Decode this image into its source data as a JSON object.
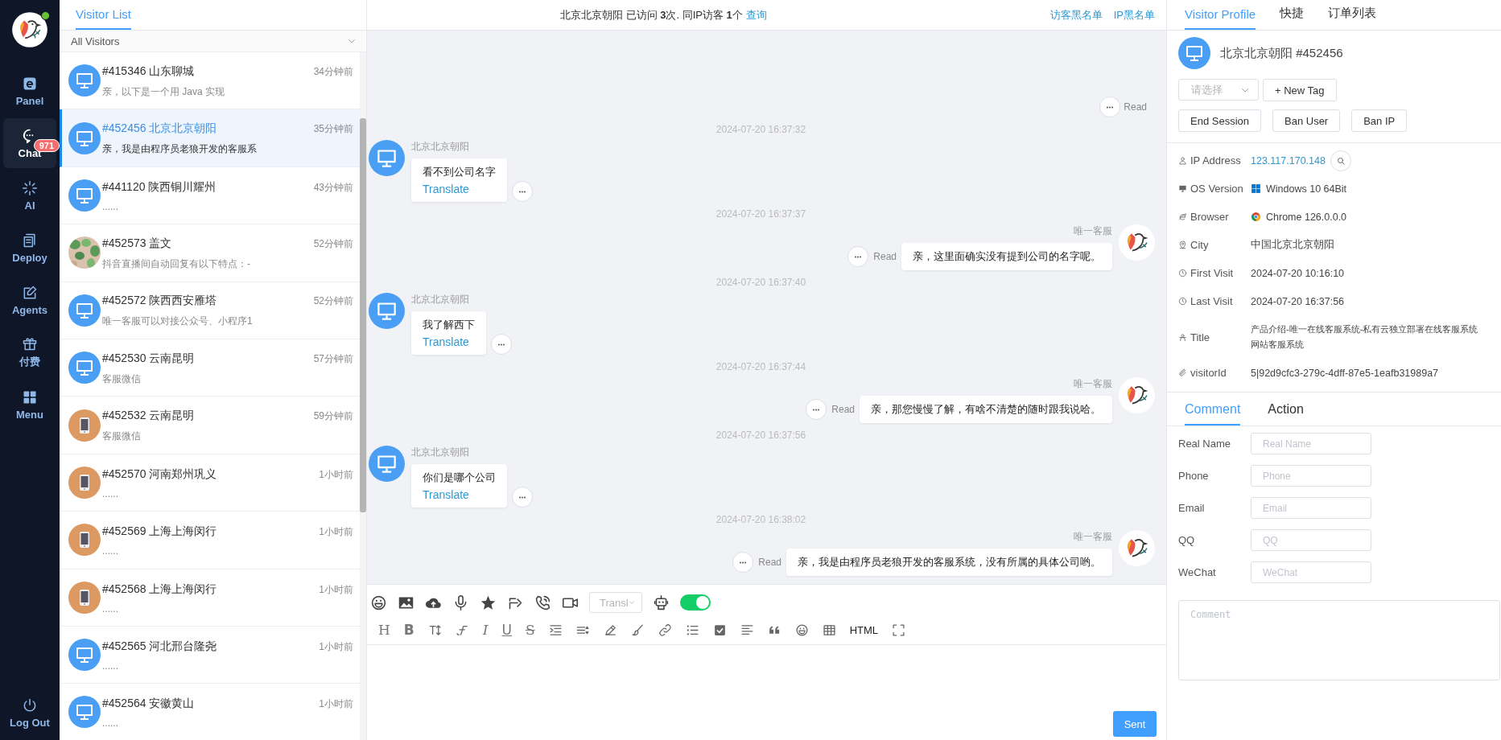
{
  "sidebar": {
    "online": true,
    "items": [
      {
        "label": "Panel",
        "selected": false
      },
      {
        "label": "Chat",
        "selected": true,
        "badge": "971"
      },
      {
        "label": "AI",
        "selected": false
      },
      {
        "label": "Deploy",
        "selected": false
      },
      {
        "label": "Agents",
        "selected": false
      },
      {
        "label": "付费",
        "selected": false
      },
      {
        "label": "Menu",
        "selected": false
      }
    ],
    "logout": "Log Out"
  },
  "visitor_list": {
    "title": "Visitor List",
    "filter": "All Visitors",
    "items": [
      {
        "name": "#415346 山东聊城",
        "time": "34分钟前",
        "preview": "亲，以下是一个用 Java 实现",
        "kind": "desktop",
        "selected": false
      },
      {
        "name": "#452456 北京北京朝阳",
        "time": "35分钟前",
        "preview": "亲，我是由程序员老狼开发的客服系",
        "kind": "desktop",
        "selected": true
      },
      {
        "name": "#441120 陕西铜川耀州",
        "time": "43分钟前",
        "preview": "......",
        "kind": "desktop",
        "selected": false
      },
      {
        "name": "#452573 盖文",
        "time": "52分钟前",
        "preview": "抖音直播间自动回复有以下特点：-",
        "kind": "picture",
        "selected": false
      },
      {
        "name": "#452572 陕西西安雁塔",
        "time": "52分钟前",
        "preview": "唯一客服可以对接公众号、小程序1",
        "kind": "desktop",
        "selected": false
      },
      {
        "name": "#452530 云南昆明",
        "time": "57分钟前",
        "preview": "客服微信",
        "kind": "desktop",
        "selected": false
      },
      {
        "name": "#452532 云南昆明",
        "time": "59分钟前",
        "preview": "客服微信",
        "kind": "mobile",
        "selected": false
      },
      {
        "name": "#452570 河南郑州巩义",
        "time": "1小时前",
        "preview": "......",
        "kind": "mobile",
        "selected": false
      },
      {
        "name": "#452569 上海上海闵行",
        "time": "1小时前",
        "preview": "......",
        "kind": "mobile",
        "selected": false
      },
      {
        "name": "#452568 上海上海闵行",
        "time": "1小时前",
        "preview": "......",
        "kind": "mobile",
        "selected": false
      },
      {
        "name": "#452565 河北邢台隆尧",
        "time": "1小时前",
        "preview": "......",
        "kind": "desktop",
        "selected": false
      },
      {
        "name": "#452564 安徽黄山",
        "time": "1小时前",
        "preview": "......",
        "kind": "desktop",
        "selected": false
      }
    ]
  },
  "chat": {
    "header": {
      "info": "北京北京朝阳 已访问 **3**次. 同IP访客 **1**个",
      "query": "查询",
      "links": [
        "访客黑名单",
        "IP黑名单"
      ]
    },
    "messages": [
      {
        "kind": "status",
        "status": "Read"
      },
      {
        "kind": "time",
        "text": "2024-07-20 16:37:32"
      },
      {
        "kind": "visitor",
        "name": "北京北京朝阳",
        "text": "看不到公司名字",
        "translate": "Translate"
      },
      {
        "kind": "time",
        "text": "2024-07-20 16:37:37"
      },
      {
        "kind": "agent",
        "name": "唯一客服",
        "text": "亲，这里面确实没有提到公司的名字呢。",
        "status": "Read"
      },
      {
        "kind": "time",
        "text": "2024-07-20 16:37:40"
      },
      {
        "kind": "visitor",
        "name": "北京北京朝阳",
        "text": "我了解西下",
        "translate": "Translate"
      },
      {
        "kind": "time",
        "text": "2024-07-20 16:37:44"
      },
      {
        "kind": "agent",
        "name": "唯一客服",
        "text": "亲，那您慢慢了解，有啥不清楚的随时跟我说哈。",
        "status": "Read"
      },
      {
        "kind": "time",
        "text": "2024-07-20 16:37:56"
      },
      {
        "kind": "visitor",
        "name": "北京北京朝阳",
        "text": "你们是哪个公司",
        "translate": "Translate"
      },
      {
        "kind": "time",
        "text": "2024-07-20 16:38:02"
      },
      {
        "kind": "agent",
        "name": "唯一客服",
        "text": "亲，我是由程序员老狼开发的客服系统，没有所属的具体公司哟。",
        "status": "Read"
      }
    ],
    "toolbar": {
      "translate_placeholder": "Transl",
      "auto_reply_on": true
    },
    "editor_labels": [
      "H",
      "B",
      "I",
      "U",
      "S",
      "HTML"
    ],
    "send": "Sent"
  },
  "profile": {
    "tabs": [
      {
        "label": "Visitor Profile",
        "selected": true
      },
      {
        "label": "快捷",
        "selected": false
      },
      {
        "label": "订单列表",
        "selected": false
      }
    ],
    "name": "北京北京朝阳 #452456",
    "tag_placeholder": "请选择",
    "new_tag": "+ New Tag",
    "actions": [
      "End Session",
      "Ban User",
      "Ban IP"
    ],
    "info": [
      {
        "label": "IP Address",
        "kind": "ip",
        "value": "123.117.170.148"
      },
      {
        "label": "OS Version",
        "kind": "os",
        "value": "Windows 10 64Bit"
      },
      {
        "label": "Browser",
        "kind": "browser",
        "value": "Chrome 126.0.0.0"
      },
      {
        "label": "City",
        "kind": "text",
        "value": "中国北京北京朝阳"
      },
      {
        "label": "First Visit",
        "kind": "text",
        "value": "2024-07-20 10:16:10"
      },
      {
        "label": "Last Visit",
        "kind": "text",
        "value": "2024-07-20 16:37:56"
      },
      {
        "label": "Title",
        "kind": "lines",
        "lines": [
          "产品介绍-唯一在线客服系统-私有云独立部署在线客服系统",
          "网站客服系统"
        ]
      },
      {
        "label": "visitorId",
        "kind": "text",
        "value": "5|92d9cfc3-279c-4dff-87e5-1eafb31989a7"
      }
    ],
    "comment_tabs": [
      {
        "label": "Comment",
        "selected": true
      },
      {
        "label": "Action",
        "selected": false
      }
    ],
    "fields": [
      {
        "label": "Real Name",
        "placeholder": "Real Name"
      },
      {
        "label": "Phone",
        "placeholder": "Phone"
      },
      {
        "label": "Email",
        "placeholder": "Email"
      },
      {
        "label": "QQ",
        "placeholder": "QQ"
      },
      {
        "label": "WeChat",
        "placeholder": "WeChat"
      }
    ],
    "comment_placeholder": "Comment"
  }
}
